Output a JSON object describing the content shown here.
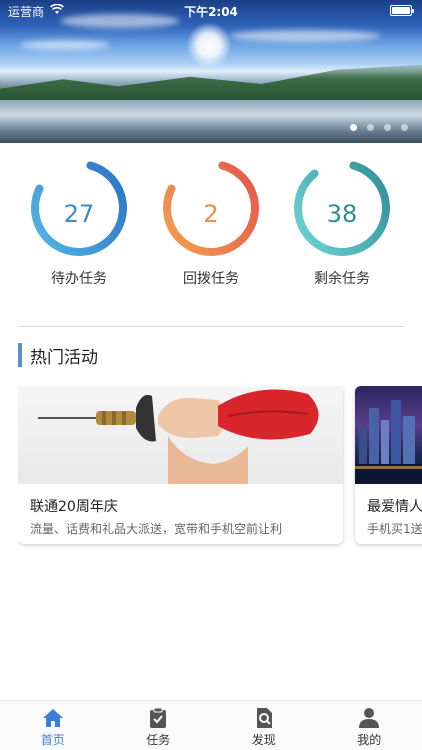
{
  "status_bar": {
    "carrier": "运营商",
    "time": "下午2:04"
  },
  "banner": {
    "page_count": 4,
    "active_index": 0
  },
  "stats": [
    {
      "value": "27",
      "label": "待办任务",
      "progress": 0.78,
      "color_start": "#56b6e6",
      "color_end": "#2b72c4",
      "text_color": "#3b8ad0"
    },
    {
      "value": "2",
      "label": "回拨任务",
      "progress": 0.78,
      "color_start": "#f2a052",
      "color_end": "#e4554a",
      "text_color": "#e98f4a"
    },
    {
      "value": "38",
      "label": "剩余任务",
      "progress": 0.85,
      "color_start": "#6fd6d6",
      "color_end": "#2f8d95",
      "text_color": "#2f8d95"
    }
  ],
  "section": {
    "title": "热门活动",
    "accent": "#5a8fd1"
  },
  "activities": [
    {
      "title": "联通20周年庆",
      "desc": "流量、话费和礼品大派送，宽带和手机空前让利"
    },
    {
      "title": "最爱情人",
      "desc": "手机买1送"
    }
  ],
  "tabbar": {
    "active_color": "#3b7fd4",
    "items": [
      {
        "label": "首页",
        "icon": "home-icon",
        "active": true
      },
      {
        "label": "任务",
        "icon": "clipboard-icon",
        "active": false
      },
      {
        "label": "发现",
        "icon": "search-document-icon",
        "active": false
      },
      {
        "label": "我的",
        "icon": "user-icon",
        "active": false
      }
    ]
  }
}
